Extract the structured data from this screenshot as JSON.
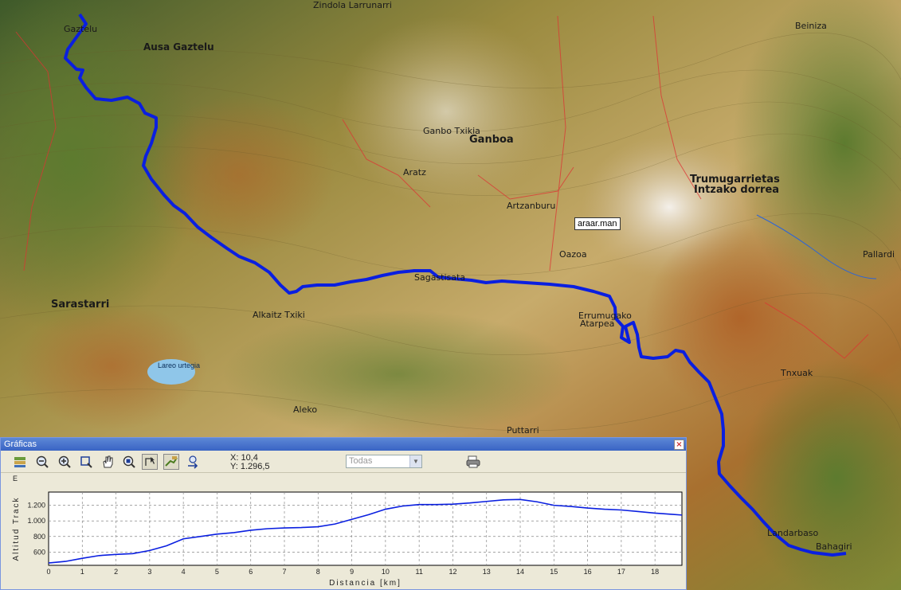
{
  "map": {
    "labels": {
      "ausa_gaztelu": "Ausa Gaztelu",
      "zindola_larrunarri": "Zindola Larrunarri",
      "gaztelu": "Gaztelu",
      "ganboa": "Ganboa",
      "aratz": "Aratz",
      "artzanburu": "Artzanburu",
      "trumugarrietas": "Trumugarrietas",
      "intzako_dorrea": "Intzako dorrea",
      "sarastarri": "Sarastarri",
      "alkaitz_txiki": "Alkaitz Txiki",
      "aleko": "Aleko",
      "puttarri": "Puttarri",
      "errumugako": "Errumugako",
      "atarpea": "Atarpea",
      "oazoa": "Oazoa",
      "pallardi": "Pallardi",
      "tnxuak": "Tnxuak",
      "landarbaso": "Landarbaso",
      "bahagiri": "Bahagiri",
      "lizarrusti_lake": "Lareo urtegia",
      "beiniza": "Beiniza",
      "sagastisata": "Sagastisata",
      "ganbo_txikia": "Ganbo Txikia"
    },
    "tooltip": "araar.man",
    "colors": {
      "track": "#0a1fe0"
    }
  },
  "panel": {
    "title": "Gráficas",
    "close_icon": "close-icon",
    "toolbar": {
      "icons": [
        "layers-icon",
        "zoom-out-icon",
        "zoom-in-icon",
        "zoom-rect-icon",
        "pan-hand-icon",
        "zoom-extent-icon",
        "pointer-icon",
        "track-edit-icon",
        "export-icon"
      ],
      "x_label": "X: 10,4",
      "y_label": "Y: 1.296,5",
      "dropdown_value": "Todas",
      "print_icon": "print-icon"
    },
    "side_label": "E"
  },
  "chart_data": {
    "type": "line",
    "title": "",
    "xlabel": "Distancia [km]",
    "ylabel": "Altitud Track",
    "xlim": [
      0,
      18.8
    ],
    "ylim": [
      430,
      1370
    ],
    "x_ticks": [
      "0",
      "1",
      "2",
      "3",
      "4",
      "5",
      "6",
      "7",
      "8",
      "9",
      "10",
      "11",
      "12",
      "13",
      "14",
      "15",
      "16",
      "17",
      "18"
    ],
    "y_ticks": [
      "600",
      "800",
      "1.000",
      "1.200"
    ],
    "y_tick_values": [
      600,
      800,
      1000,
      1200
    ],
    "series": [
      {
        "color": "#0a1fe0",
        "x": [
          0,
          0.5,
          1,
          1.5,
          2,
          2.5,
          3,
          3.5,
          4,
          4.5,
          5,
          5.5,
          6,
          6.5,
          7,
          7.5,
          8,
          8.5,
          9,
          9.5,
          10,
          10.5,
          11,
          11.5,
          12,
          12.5,
          13,
          13.5,
          14,
          14.5,
          15,
          15.5,
          16,
          16.5,
          17,
          17.5,
          18,
          18.5,
          18.8
        ],
        "y": [
          460,
          480,
          520,
          555,
          570,
          580,
          620,
          680,
          770,
          800,
          830,
          850,
          880,
          900,
          910,
          915,
          925,
          960,
          1020,
          1080,
          1150,
          1190,
          1210,
          1210,
          1215,
          1230,
          1250,
          1270,
          1275,
          1245,
          1200,
          1185,
          1165,
          1150,
          1140,
          1120,
          1100,
          1085,
          1075
        ]
      }
    ]
  }
}
